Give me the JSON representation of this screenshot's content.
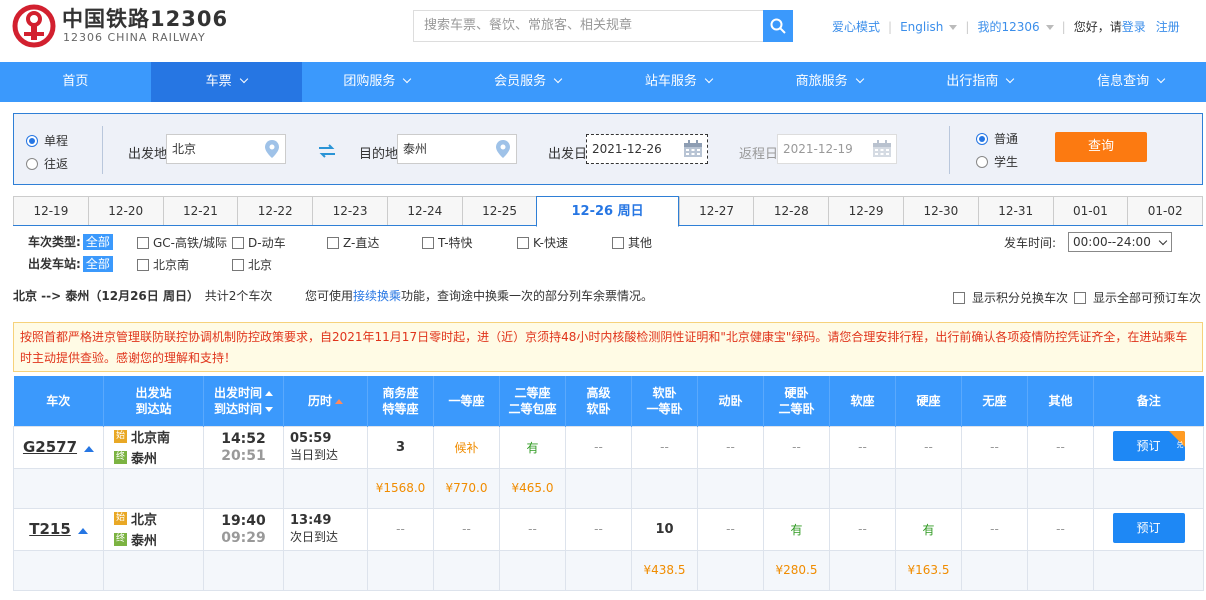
{
  "brand": {
    "cn": "中国铁路12306",
    "en": "12306 CHINA RAILWAY"
  },
  "search": {
    "placeholder": "搜索车票、餐饮、常旅客、相关规章"
  },
  "toplinks": {
    "care": "爱心模式",
    "lang": "English",
    "my": "我的12306",
    "greet": "您好，请",
    "login": "登录",
    "register": "注册"
  },
  "nav": [
    "首页",
    "车票",
    "团购服务",
    "会员服务",
    "站车服务",
    "商旅服务",
    "出行指南",
    "信息查询"
  ],
  "form": {
    "oneway": "单程",
    "roundtrip": "往返",
    "from_label": "出发地",
    "from_value": "北京",
    "to_label": "目的地",
    "to_value": "泰州",
    "date_label": "出发日",
    "date_value": "2021-12-26",
    "return_label": "返程日",
    "return_value": "2021-12-19",
    "normal": "普通",
    "student": "学生",
    "query": "查询"
  },
  "dates": [
    "12-19",
    "12-20",
    "12-21",
    "12-22",
    "12-23",
    "12-24",
    "12-25",
    "12-26 周日",
    "12-27",
    "12-28",
    "12-29",
    "12-30",
    "12-31",
    "01-01",
    "01-02"
  ],
  "filters": {
    "type_label": "车次类型:",
    "all": "全部",
    "types": [
      "GC-高铁/城际",
      "D-动车",
      "Z-直达",
      "T-特快",
      "K-快速",
      "其他"
    ],
    "station_label": "出发车站:",
    "stations": [
      "北京南",
      "北京"
    ],
    "time_label": "发车时间:",
    "time_value": "00:00--24:00"
  },
  "summary": {
    "route": "北京 --> 泰州（12月26日 周日）",
    "count": "共计2个车次"
  },
  "tip": {
    "pre": "您可使用",
    "link": "接续换乘",
    "post": "功能，查询途中换乘一次的部分列车余票情况。"
  },
  "options": {
    "points": "显示积分兑换车次",
    "all": "显示全部可预订车次"
  },
  "notice": "按照首都严格进京管理联防联控协调机制防控政策要求，自2021年11月17日零时起，进（近）京须持48小时内核酸检测阴性证明和\"北京健康宝\"绿码。请您合理安排行程，出行前确认各项疫情防控凭证齐全，在进站乘车时主动提供查验。感谢您的理解和支持！",
  "table": {
    "headers": [
      "车次",
      "出发站\n到达站",
      "出发时间\n到达时间",
      "历时",
      "商务座\n特等座",
      "一等座",
      "二等座\n二等包座",
      "高级\n软卧",
      "软卧\n一等卧",
      "动卧",
      "硬卧\n二等卧",
      "软座",
      "硬座",
      "无座",
      "其他",
      "备注"
    ],
    "rows": [
      {
        "train": "G2577",
        "from": "北京南",
        "to": "泰州",
        "dep": "14:52",
        "arr": "20:51",
        "dur": "05:59",
        "arrive_day": "当日到达",
        "seats": [
          "3",
          "候补",
          "有",
          "--",
          "--",
          "--",
          "--",
          "--",
          "--",
          "--",
          "--"
        ],
        "prices": [
          "¥1568.0",
          "¥770.0",
          "¥465.0",
          "",
          "",
          "",
          "",
          "",
          "",
          "",
          ""
        ],
        "book": "预订",
        "badge": "兑",
        "start": "始",
        "end": "终"
      },
      {
        "train": "T215",
        "from": "北京",
        "to": "泰州",
        "dep": "19:40",
        "arr": "09:29",
        "dur": "13:49",
        "arrive_day": "次日到达",
        "seats": [
          "--",
          "--",
          "--",
          "--",
          "10",
          "--",
          "有",
          "--",
          "有",
          "--",
          "--"
        ],
        "prices": [
          "",
          "",
          "",
          "",
          "¥438.5",
          "",
          "¥280.5",
          "",
          "¥163.5",
          "",
          ""
        ],
        "book": "预订",
        "start": "始",
        "end": "终"
      }
    ]
  },
  "colors": {
    "accent": "#3b99fc",
    "active": "#2676e3",
    "query": "#fc7a11",
    "notice": "#e0341b"
  }
}
